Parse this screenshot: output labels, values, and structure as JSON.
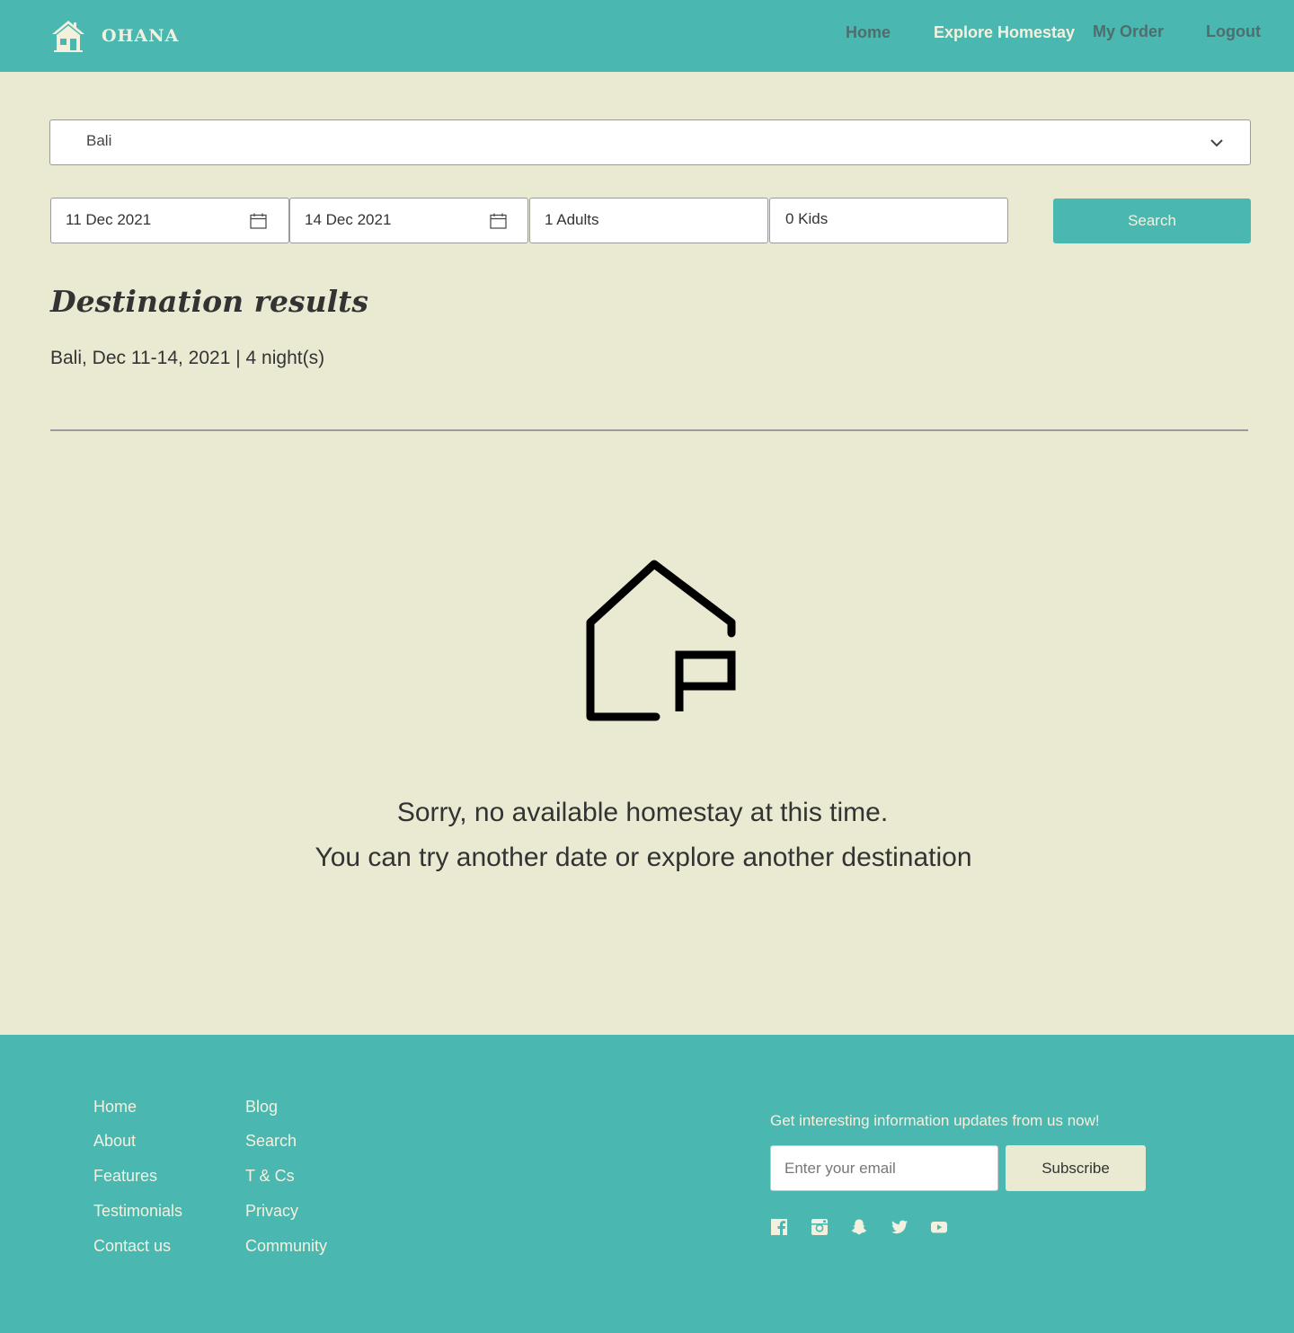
{
  "header": {
    "brand": "OHANA",
    "nav": [
      "Home",
      "Explore Homestay",
      "My Order",
      "Logout"
    ],
    "active_nav": "Explore Homestay"
  },
  "search": {
    "destination": "Bali",
    "check_in": "11 Dec 2021",
    "check_out": "14 Dec 2021",
    "adults": "1 Adults",
    "kids": "0 Kids",
    "search_label": "Search"
  },
  "results": {
    "title": "Destination results",
    "summary": "Bali, Dec 11-14, 2021 | 4 night(s)"
  },
  "empty_state": {
    "line1": "Sorry, no available homestay at this time.",
    "line2": "You can try another date or explore another destination"
  },
  "footer": {
    "col1": [
      "Home",
      "About",
      "Features",
      "Testimonials",
      "Contact us"
    ],
    "col2": [
      "Blog",
      "Search",
      "T & Cs",
      "Privacy",
      "Community"
    ],
    "newsletter_text": "Get interesting information updates from us now!",
    "email_placeholder": "Enter your email",
    "subscribe_label": "Subscribe",
    "social_icons": [
      "facebook-icon",
      "instagram-icon",
      "snapchat-icon",
      "twitter-icon",
      "youtube-icon"
    ]
  },
  "colors": {
    "primary": "#4BB7B1",
    "background": "#EAEAD3",
    "light_text": "#F3F1DE",
    "muted_nav": "#4E6E6E"
  }
}
